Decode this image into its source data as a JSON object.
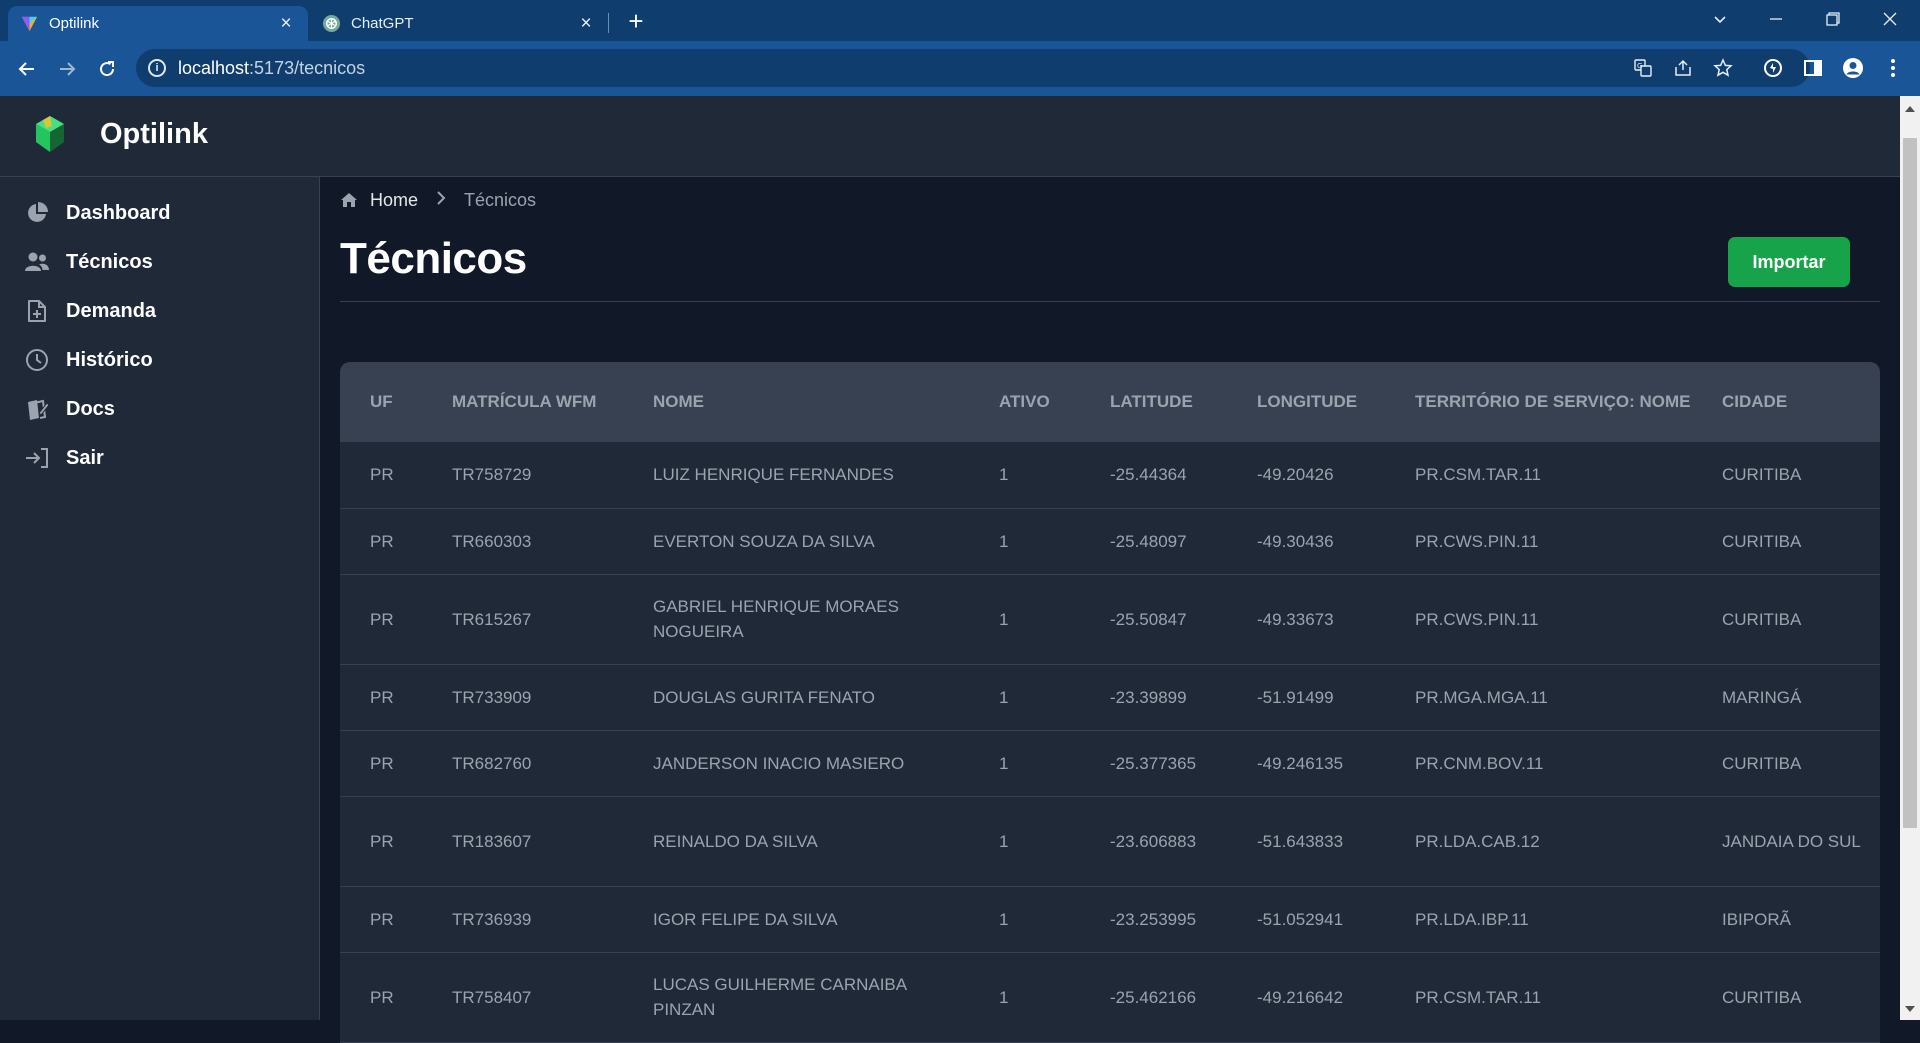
{
  "browser": {
    "tabs": [
      {
        "title": "Optilink",
        "close": "×"
      },
      {
        "title": "ChatGPT",
        "close": "×"
      }
    ],
    "new_tab": "+",
    "url_host": "localhost",
    "url_rest": ":5173/tecnicos"
  },
  "app": {
    "brand": "Optilink",
    "colors": {
      "accent": "#16a34a",
      "sidebar": "#1f2937",
      "background": "#111827",
      "table_header": "#374151"
    }
  },
  "sidebar": {
    "items": [
      {
        "label": "Dashboard",
        "icon": "pie-chart-icon"
      },
      {
        "label": "Técnicos",
        "icon": "users-icon"
      },
      {
        "label": "Demanda",
        "icon": "file-plus-icon"
      },
      {
        "label": "Histórico",
        "icon": "clock-icon"
      },
      {
        "label": "Docs",
        "icon": "docs-edit-icon"
      },
      {
        "label": "Sair",
        "icon": "sign-in-icon"
      }
    ]
  },
  "breadcrumb": {
    "home": "Home",
    "current": "Técnicos"
  },
  "page": {
    "title": "Técnicos",
    "import_label": "Importar"
  },
  "table": {
    "headers": [
      "UF",
      "Matrícula WFM",
      "Nome",
      "Ativo",
      "Latitude",
      "Longitude",
      "Território de Serviço: Nome",
      "Cidade"
    ],
    "rows": [
      [
        "PR",
        "TR758729",
        "LUIZ HENRIQUE FERNANDES",
        "1",
        "-25.44364",
        "-49.20426",
        "PR.CSM.TAR.11",
        "CURITIBA"
      ],
      [
        "PR",
        "TR660303",
        "EVERTON SOUZA DA SILVA",
        "1",
        "-25.48097",
        "-49.30436",
        "PR.CWS.PIN.11",
        "CURITIBA"
      ],
      [
        "PR",
        "TR615267",
        "GABRIEL HENRIQUE MORAES NOGUEIRA",
        "1",
        "-25.50847",
        "-49.33673",
        "PR.CWS.PIN.11",
        "CURITIBA"
      ],
      [
        "PR",
        "TR733909",
        "DOUGLAS GURITA FENATO",
        "1",
        "-23.39899",
        "-51.91499",
        "PR.MGA.MGA.11",
        "MARINGÁ"
      ],
      [
        "PR",
        "TR682760",
        "JANDERSON INACIO MASIERO",
        "1",
        "-25.377365",
        "-49.246135",
        "PR.CNM.BOV.11",
        "CURITIBA"
      ],
      [
        "PR",
        "TR183607",
        "REINALDO DA SILVA",
        "1",
        "-23.606883",
        "-51.643833",
        "PR.LDA.CAB.12",
        "JANDAIA DO SUL"
      ],
      [
        "PR",
        "TR736939",
        "IGOR FELIPE DA SILVA",
        "1",
        "-23.253995",
        "-51.052941",
        "PR.LDA.IBP.11",
        "IBIPORÃ"
      ],
      [
        "PR",
        "TR758407",
        "LUCAS GUILHERME CARNAIBA PINZAN",
        "1",
        "-25.462166",
        "-49.216642",
        "PR.CSM.TAR.11",
        "CURITIBA"
      ]
    ]
  }
}
